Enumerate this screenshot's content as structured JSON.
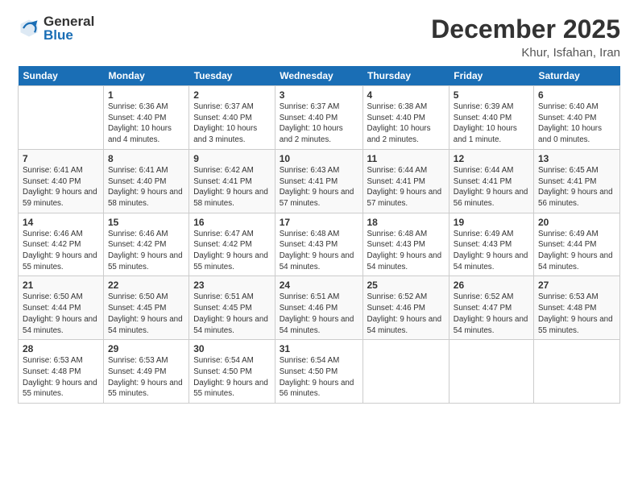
{
  "logo": {
    "general": "General",
    "blue": "Blue"
  },
  "title": "December 2025",
  "subtitle": "Khur, Isfahan, Iran",
  "days_of_week": [
    "Sunday",
    "Monday",
    "Tuesday",
    "Wednesday",
    "Thursday",
    "Friday",
    "Saturday"
  ],
  "weeks": [
    [
      {
        "day": "",
        "sunrise": "",
        "sunset": "",
        "daylight": ""
      },
      {
        "day": "1",
        "sunrise": "Sunrise: 6:36 AM",
        "sunset": "Sunset: 4:40 PM",
        "daylight": "Daylight: 10 hours and 4 minutes."
      },
      {
        "day": "2",
        "sunrise": "Sunrise: 6:37 AM",
        "sunset": "Sunset: 4:40 PM",
        "daylight": "Daylight: 10 hours and 3 minutes."
      },
      {
        "day": "3",
        "sunrise": "Sunrise: 6:37 AM",
        "sunset": "Sunset: 4:40 PM",
        "daylight": "Daylight: 10 hours and 2 minutes."
      },
      {
        "day": "4",
        "sunrise": "Sunrise: 6:38 AM",
        "sunset": "Sunset: 4:40 PM",
        "daylight": "Daylight: 10 hours and 2 minutes."
      },
      {
        "day": "5",
        "sunrise": "Sunrise: 6:39 AM",
        "sunset": "Sunset: 4:40 PM",
        "daylight": "Daylight: 10 hours and 1 minute."
      },
      {
        "day": "6",
        "sunrise": "Sunrise: 6:40 AM",
        "sunset": "Sunset: 4:40 PM",
        "daylight": "Daylight: 10 hours and 0 minutes."
      }
    ],
    [
      {
        "day": "7",
        "sunrise": "Sunrise: 6:41 AM",
        "sunset": "Sunset: 4:40 PM",
        "daylight": "Daylight: 9 hours and 59 minutes."
      },
      {
        "day": "8",
        "sunrise": "Sunrise: 6:41 AM",
        "sunset": "Sunset: 4:40 PM",
        "daylight": "Daylight: 9 hours and 58 minutes."
      },
      {
        "day": "9",
        "sunrise": "Sunrise: 6:42 AM",
        "sunset": "Sunset: 4:41 PM",
        "daylight": "Daylight: 9 hours and 58 minutes."
      },
      {
        "day": "10",
        "sunrise": "Sunrise: 6:43 AM",
        "sunset": "Sunset: 4:41 PM",
        "daylight": "Daylight: 9 hours and 57 minutes."
      },
      {
        "day": "11",
        "sunrise": "Sunrise: 6:44 AM",
        "sunset": "Sunset: 4:41 PM",
        "daylight": "Daylight: 9 hours and 57 minutes."
      },
      {
        "day": "12",
        "sunrise": "Sunrise: 6:44 AM",
        "sunset": "Sunset: 4:41 PM",
        "daylight": "Daylight: 9 hours and 56 minutes."
      },
      {
        "day": "13",
        "sunrise": "Sunrise: 6:45 AM",
        "sunset": "Sunset: 4:41 PM",
        "daylight": "Daylight: 9 hours and 56 minutes."
      }
    ],
    [
      {
        "day": "14",
        "sunrise": "Sunrise: 6:46 AM",
        "sunset": "Sunset: 4:42 PM",
        "daylight": "Daylight: 9 hours and 55 minutes."
      },
      {
        "day": "15",
        "sunrise": "Sunrise: 6:46 AM",
        "sunset": "Sunset: 4:42 PM",
        "daylight": "Daylight: 9 hours and 55 minutes."
      },
      {
        "day": "16",
        "sunrise": "Sunrise: 6:47 AM",
        "sunset": "Sunset: 4:42 PM",
        "daylight": "Daylight: 9 hours and 55 minutes."
      },
      {
        "day": "17",
        "sunrise": "Sunrise: 6:48 AM",
        "sunset": "Sunset: 4:43 PM",
        "daylight": "Daylight: 9 hours and 54 minutes."
      },
      {
        "day": "18",
        "sunrise": "Sunrise: 6:48 AM",
        "sunset": "Sunset: 4:43 PM",
        "daylight": "Daylight: 9 hours and 54 minutes."
      },
      {
        "day": "19",
        "sunrise": "Sunrise: 6:49 AM",
        "sunset": "Sunset: 4:43 PM",
        "daylight": "Daylight: 9 hours and 54 minutes."
      },
      {
        "day": "20",
        "sunrise": "Sunrise: 6:49 AM",
        "sunset": "Sunset: 4:44 PM",
        "daylight": "Daylight: 9 hours and 54 minutes."
      }
    ],
    [
      {
        "day": "21",
        "sunrise": "Sunrise: 6:50 AM",
        "sunset": "Sunset: 4:44 PM",
        "daylight": "Daylight: 9 hours and 54 minutes."
      },
      {
        "day": "22",
        "sunrise": "Sunrise: 6:50 AM",
        "sunset": "Sunset: 4:45 PM",
        "daylight": "Daylight: 9 hours and 54 minutes."
      },
      {
        "day": "23",
        "sunrise": "Sunrise: 6:51 AM",
        "sunset": "Sunset: 4:45 PM",
        "daylight": "Daylight: 9 hours and 54 minutes."
      },
      {
        "day": "24",
        "sunrise": "Sunrise: 6:51 AM",
        "sunset": "Sunset: 4:46 PM",
        "daylight": "Daylight: 9 hours and 54 minutes."
      },
      {
        "day": "25",
        "sunrise": "Sunrise: 6:52 AM",
        "sunset": "Sunset: 4:46 PM",
        "daylight": "Daylight: 9 hours and 54 minutes."
      },
      {
        "day": "26",
        "sunrise": "Sunrise: 6:52 AM",
        "sunset": "Sunset: 4:47 PM",
        "daylight": "Daylight: 9 hours and 54 minutes."
      },
      {
        "day": "27",
        "sunrise": "Sunrise: 6:53 AM",
        "sunset": "Sunset: 4:48 PM",
        "daylight": "Daylight: 9 hours and 55 minutes."
      }
    ],
    [
      {
        "day": "28",
        "sunrise": "Sunrise: 6:53 AM",
        "sunset": "Sunset: 4:48 PM",
        "daylight": "Daylight: 9 hours and 55 minutes."
      },
      {
        "day": "29",
        "sunrise": "Sunrise: 6:53 AM",
        "sunset": "Sunset: 4:49 PM",
        "daylight": "Daylight: 9 hours and 55 minutes."
      },
      {
        "day": "30",
        "sunrise": "Sunrise: 6:54 AM",
        "sunset": "Sunset: 4:50 PM",
        "daylight": "Daylight: 9 hours and 55 minutes."
      },
      {
        "day": "31",
        "sunrise": "Sunrise: 6:54 AM",
        "sunset": "Sunset: 4:50 PM",
        "daylight": "Daylight: 9 hours and 56 minutes."
      },
      {
        "day": "",
        "sunrise": "",
        "sunset": "",
        "daylight": ""
      },
      {
        "day": "",
        "sunrise": "",
        "sunset": "",
        "daylight": ""
      },
      {
        "day": "",
        "sunrise": "",
        "sunset": "",
        "daylight": ""
      }
    ]
  ]
}
